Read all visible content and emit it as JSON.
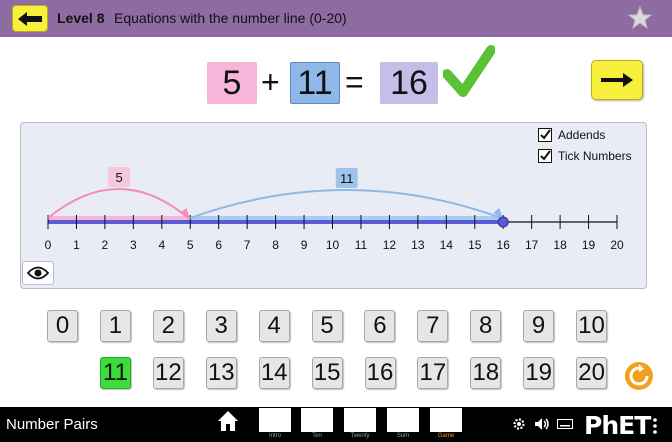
{
  "header": {
    "level_title": "Level 8",
    "level_desc": "Equations with the number line (0-20)",
    "back_icon": "left-arrow-icon",
    "star_icon": "star-icon"
  },
  "equation": {
    "addend1": "5",
    "plus": "+",
    "addend2": "11",
    "equals": "=",
    "total": "16",
    "result_icon": "checkmark-icon",
    "next_icon": "right-arrow-icon"
  },
  "number_line": {
    "min": 0,
    "max": 20,
    "ticks": [
      "0",
      "1",
      "2",
      "3",
      "4",
      "5",
      "6",
      "7",
      "8",
      "9",
      "10",
      "11",
      "12",
      "13",
      "14",
      "15",
      "16",
      "17",
      "18",
      "19",
      "20"
    ],
    "addend1_jump": {
      "from": 0,
      "to": 5,
      "label": "5"
    },
    "addend2_jump": {
      "from": 5,
      "to": 16,
      "label": "11"
    },
    "checkboxes": [
      {
        "label": "Addends",
        "checked": true
      },
      {
        "label": "Tick Numbers",
        "checked": true
      }
    ],
    "eye_icon": "eye-icon"
  },
  "keypad": {
    "row1": [
      "0",
      "1",
      "2",
      "3",
      "4",
      "5",
      "6",
      "7",
      "8",
      "9",
      "10"
    ],
    "row2": [
      "11",
      "12",
      "13",
      "14",
      "15",
      "16",
      "17",
      "18",
      "19",
      "20"
    ],
    "selected": "11",
    "reset_icon": "reset-icon"
  },
  "navbar": {
    "sim_title": "Number Pairs",
    "home_icon": "home-icon",
    "screens": [
      {
        "label": "Intro",
        "active": false
      },
      {
        "label": "Ten",
        "active": false
      },
      {
        "label": "Twenty",
        "active": false
      },
      {
        "label": "Sum",
        "active": false
      },
      {
        "label": "Game",
        "active": true
      }
    ],
    "settings_icon": "gear-icon",
    "sound_icon": "speaker-icon",
    "keyboard_icon": "keyboard-icon",
    "logo": "PhET",
    "menu_icon": "kebab-menu-icon"
  },
  "colors": {
    "header_bg": "#8e6ba0",
    "yellow_button": "#f8ee3c",
    "addend1_pink": "#f7b6d9",
    "addend2_blue": "#8fb8e8",
    "total_purple": "#c6bde8",
    "check_green": "#5bc236",
    "selected_green": "#3ddc3d",
    "line_blue": "#5b5bd6",
    "reset_orange": "#f0a21c"
  }
}
